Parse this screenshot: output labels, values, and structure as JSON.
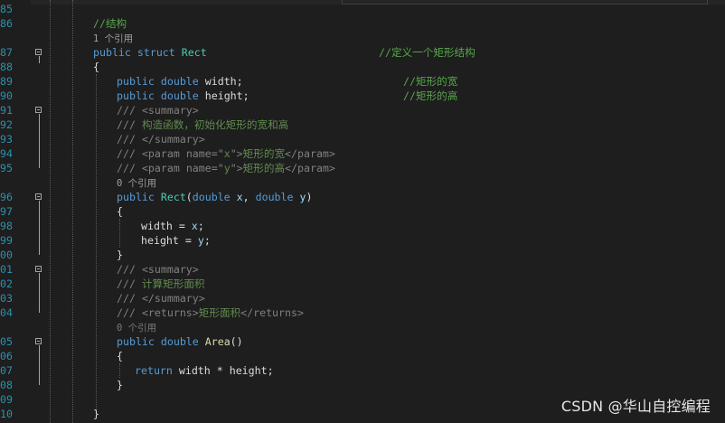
{
  "editor": {
    "line_numbers": [
      "85",
      "86",
      "",
      "87",
      "88",
      "89",
      "90",
      "91",
      "92",
      "93",
      "94",
      "95",
      "",
      "96",
      "97",
      "98",
      "99",
      "00",
      "01",
      "02",
      "03",
      "04",
      "",
      "05",
      "06",
      "07",
      "08",
      "09",
      "10"
    ],
    "ref_counts": {
      "struct": "1 个引用",
      "ctor": "0 个引用",
      "area": "0 个引用"
    },
    "lines": {
      "c86": "//结构",
      "c87_kw1": "public",
      "c87_kw2": "struct",
      "c87_type": "Rect",
      "c87_comment": "//定义一个矩形结构",
      "c88": "{",
      "c89_kw1": "public",
      "c89_kw2": "double",
      "c89_id": "width;",
      "c89_comment": "//矩形的宽",
      "c90_kw1": "public",
      "c90_kw2": "double",
      "c90_id": "height;",
      "c90_comment": "//矩形的高",
      "c91_pre": "///",
      "c91_tag": "<summary>",
      "c92_pre": "///",
      "c92_text": "构造函数，初始化矩形的宽和高",
      "c93_pre": "///",
      "c93_tag": "</summary>",
      "c94_pre": "///",
      "c94_tag1": "<param",
      "c94_attr": "name=",
      "c94_q1": "\"",
      "c94_val": "x",
      "c94_q2": "\"",
      "c94_gt": ">",
      "c94_text": "矩形的宽",
      "c94_tag2": "</param>",
      "c95_pre": "///",
      "c95_tag1": "<param",
      "c95_attr": "name=",
      "c95_q1": "\"",
      "c95_val": "y",
      "c95_q2": "\"",
      "c95_gt": ">",
      "c95_text": "矩形的高",
      "c95_tag2": "</param>",
      "c96_kw1": "public",
      "c96_type": "Rect",
      "c96_p1": "(",
      "c96_kw2": "double",
      "c96_a1": "x",
      "c96_comma": ",",
      "c96_kw3": "double",
      "c96_a2": "y",
      "c96_p2": ")",
      "c97": "{",
      "c98_id": "width",
      "c98_eq": " = ",
      "c98_p": "x",
      "c98_semi": ";",
      "c99_id": "height",
      "c99_eq": " = ",
      "c99_p": "y",
      "c99_semi": ";",
      "c00": "}",
      "c01_pre": "///",
      "c01_tag": "<summary>",
      "c02_pre": "///",
      "c02_text": "计算矩形面积",
      "c03_pre": "///",
      "c03_tag": "</summary>",
      "c04_pre": "///",
      "c04_tag1": "<returns>",
      "c04_text": "矩形面积",
      "c04_tag2": "</returns>",
      "c05_kw1": "public",
      "c05_kw2": "double",
      "c05_fn": "Area",
      "c05_p": "()",
      "c06": "{",
      "c07_kw": "return",
      "c07_expr": " width * height;",
      "c08": "}",
      "c10": "}"
    }
  },
  "watermark": "CSDN @华山自控编程"
}
